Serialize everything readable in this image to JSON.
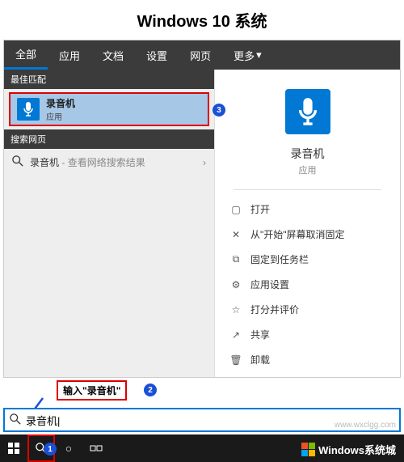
{
  "page_title": "Windows 10   系统",
  "tabs": {
    "all": "全部",
    "apps": "应用",
    "docs": "文档",
    "settings": "设置",
    "web": "网页",
    "more": "更多"
  },
  "sections": {
    "best_match": "最佳匹配",
    "search_web": "搜索网页"
  },
  "best_match": {
    "title": "录音机",
    "subtitle": "应用"
  },
  "web_search": {
    "term": "录音机",
    "hint": "查看网络搜索结果"
  },
  "preview": {
    "app_name": "录音机",
    "app_type": "应用"
  },
  "actions": {
    "open": "打开",
    "unpin_start": "从\"开始\"屏幕取消固定",
    "pin_taskbar": "固定到任务栏",
    "app_settings": "应用设置",
    "rate": "打分并评价",
    "share": "共享",
    "uninstall": "卸载"
  },
  "callouts": {
    "instruction": "输入\"录音机\"",
    "step1": "1",
    "step2": "2",
    "step3": "3"
  },
  "search": {
    "value": "录音机"
  },
  "watermark": {
    "text": "Windows系统城",
    "url": "www.wxclgg.com"
  },
  "colors": {
    "accent": "#0078d4",
    "highlight_border": "#d00000",
    "step_badge": "#1a4fd6"
  }
}
